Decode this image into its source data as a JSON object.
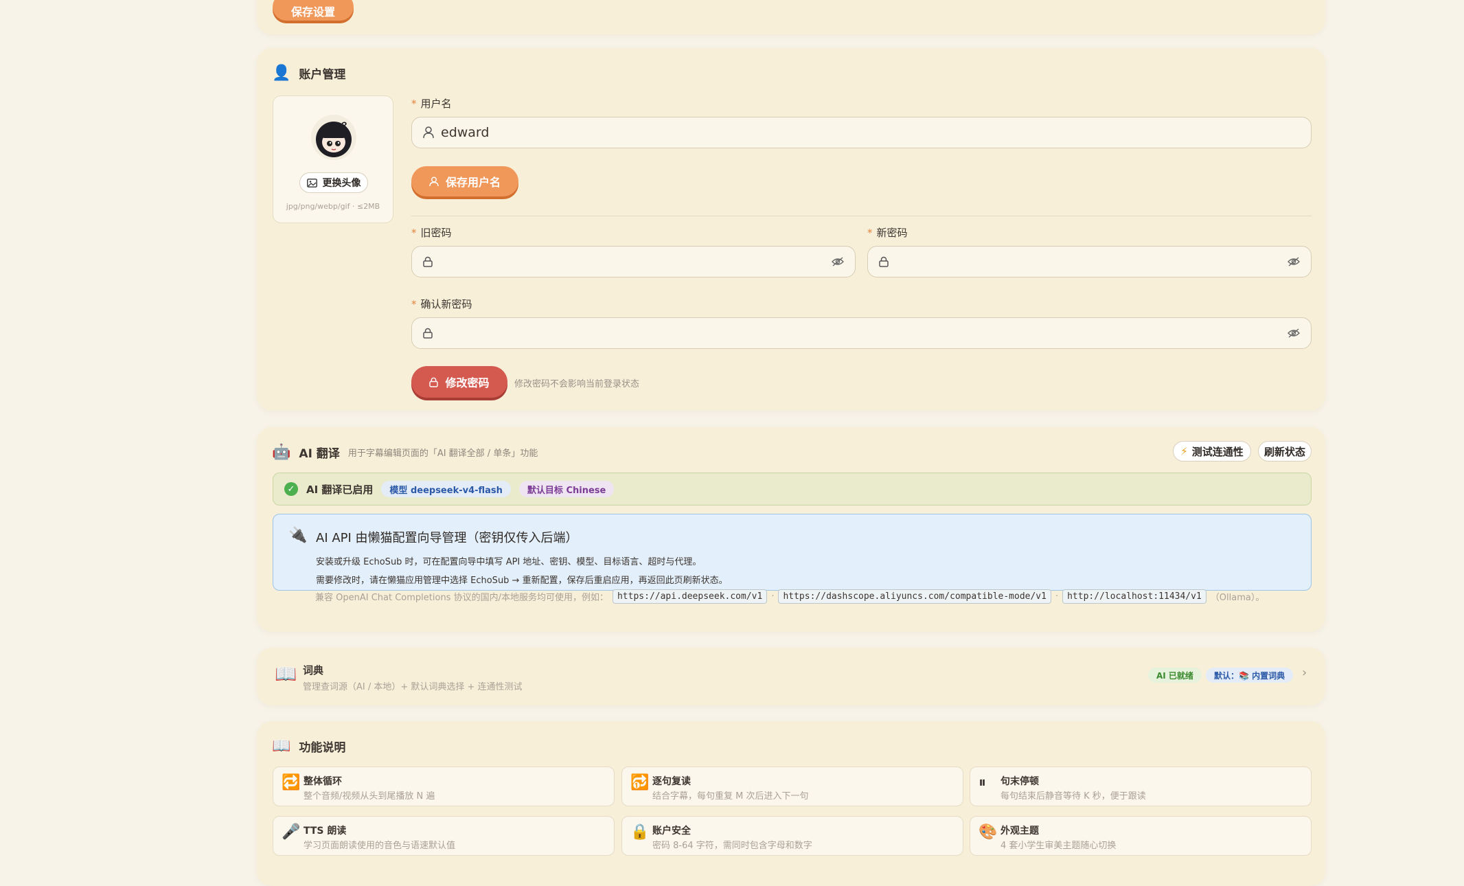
{
  "settings": {
    "save_label": "保存设置"
  },
  "account": {
    "title": "账户管理",
    "change_avatar_label": "更换头像",
    "avatar_hint": "jpg/png/webp/gif · ≤2MB",
    "username_label": "用户名",
    "username_value": "edward",
    "save_username_label": "保存用户名",
    "old_password_label": "旧密码",
    "new_password_label": "新密码",
    "confirm_password_label": "确认新密码",
    "change_password_label": "修改密码",
    "password_hint": "修改密码不会影响当前登录状态"
  },
  "ai": {
    "title": "AI 翻译",
    "subtitle": "用于字幕编辑页面的「AI 翻译全部 / 单条」功能",
    "test_label": "测试连通性",
    "refresh_label": "刷新状态",
    "status_text": "AI 翻译已启用",
    "model_tag": "模型 deepseek-v4-flash",
    "target_tag": "默认目标 Chinese",
    "info_title": "AI API 由懒猫配置向导管理（密钥仅传入后端）",
    "info_line1": "安装或升级 EchoSub 时，可在配置向导中填写 API 地址、密钥、模型、目标语言、超时与代理。",
    "info_line2": "需要修改时，请在懒猫应用管理中选择 EchoSub → 重新配置，保存后重启应用，再返回此页刷新状态。",
    "compat_prefix": "兼容 OpenAI Chat Completions 协议的国内/本地服务均可使用，例如：",
    "url1": "https://api.deepseek.com/v1",
    "url2": "https://dashscope.aliyuncs.com/compatible-mode/v1",
    "url3": "http://localhost:11434/v1",
    "compat_suffix": "（Ollama）。",
    "sep": "·"
  },
  "dictionary": {
    "title": "词典",
    "subtitle": "管理查词源（AI / 本地）+ 默认词典选择 + 连通性测试",
    "ai_ready_tag": "AI 已就绪",
    "default_tag": "默认：📚 内置词典",
    "chevron": "›"
  },
  "features": {
    "title": "功能说明",
    "items": [
      {
        "icon": "🔁",
        "title": "整体循环",
        "desc": "整个音频/视频从头到尾播放 N 遍"
      },
      {
        "icon": "🔂",
        "title": "逐句复读",
        "desc": "结合字幕，每句重复 M 次后进入下一句"
      },
      {
        "icon": "⏸",
        "title": "句末停顿",
        "desc": "每句结束后静音等待 K 秒，便于跟读"
      },
      {
        "icon": "🎤",
        "title": "TTS 朗读",
        "desc": "学习页面朗读使用的音色与语速默认值"
      },
      {
        "icon": "🔒",
        "title": "账户安全",
        "desc": "密码 8-64 字符，需同时包含字母和数字"
      },
      {
        "icon": "🎨",
        "title": "外观主题",
        "desc": "4 套小学生审美主题随心切换"
      }
    ]
  },
  "colors": {
    "accent_orange": "#f0975a",
    "danger_red": "#d4594f",
    "success_green": "#4caf50",
    "info_blue": "#e3effa"
  }
}
